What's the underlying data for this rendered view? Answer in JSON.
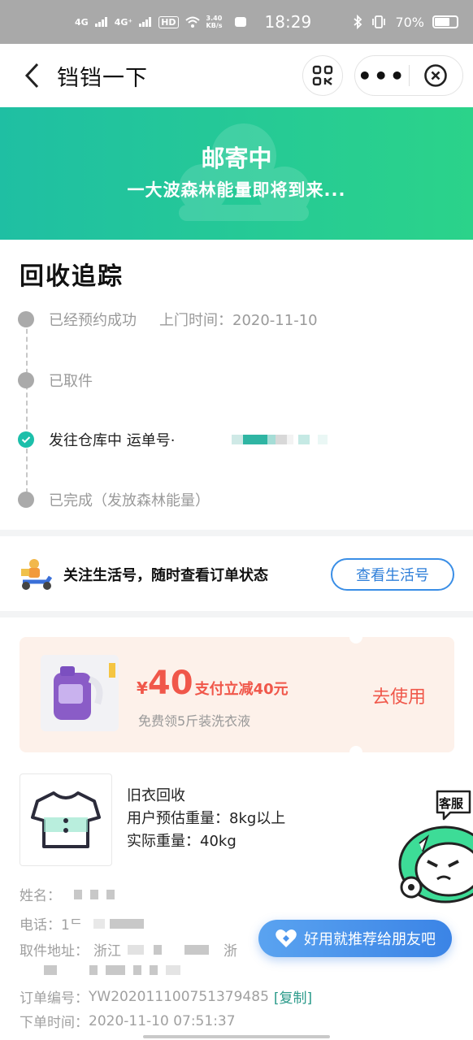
{
  "status_bar": {
    "network1": "4G",
    "network2": "4G⁺",
    "hd": "HD",
    "speed": "3.40 KB/s",
    "time": "18:29",
    "battery": "70%",
    "battery_level": 0.7
  },
  "nav": {
    "title": "铛铛一下",
    "back_icon": "chevron-left-icon",
    "scan_icon": "scan-icon",
    "more_label": "•••",
    "close_icon": "close-circle-icon"
  },
  "banner": {
    "title": "邮寄中",
    "subtitle": "一大波森林能量即将到来..."
  },
  "tracking": {
    "title": "回收追踪",
    "steps": [
      {
        "label": "已经预约成功",
        "extra": "上门时间：2020-11-10",
        "active": false
      },
      {
        "label": "已取件",
        "extra": "",
        "active": false
      },
      {
        "label": "发往仓库中 运单号·",
        "extra": "",
        "active": true
      },
      {
        "label": "已完成（发放森林能量）",
        "extra": "",
        "active": false
      }
    ]
  },
  "follow": {
    "text": "关注生活号，随时查看订单状态",
    "button": "查看生活号"
  },
  "coupon": {
    "yen": "¥",
    "amount": "40",
    "desc": "支付立减40元",
    "sub": "免费领5斤装洗衣液",
    "action": "去使用"
  },
  "goods": {
    "name": "旧衣回收",
    "estimated": "用户预估重量：8kg以上",
    "actual": "实际重量：40kg"
  },
  "order_info": {
    "name_label": "姓名：",
    "phone_label": "电话：",
    "phone_prefix": "1ᄃ",
    "address_label": "取件地址：",
    "address_prefix": "浙江",
    "address_mid": "浙",
    "order_no_label": "订单编号：",
    "order_no": "YW202011100751379485",
    "copy_label": "[复制]",
    "time_label": "下单时间：",
    "time": "2020-11-10 07:51:37"
  },
  "float": {
    "kf_label": "客服",
    "share_label": "好用就推荐给朋友吧"
  },
  "colors": {
    "brand_green": "#1cbfaa",
    "coupon_red": "#f0574a",
    "link_blue": "#2f7fd9"
  }
}
